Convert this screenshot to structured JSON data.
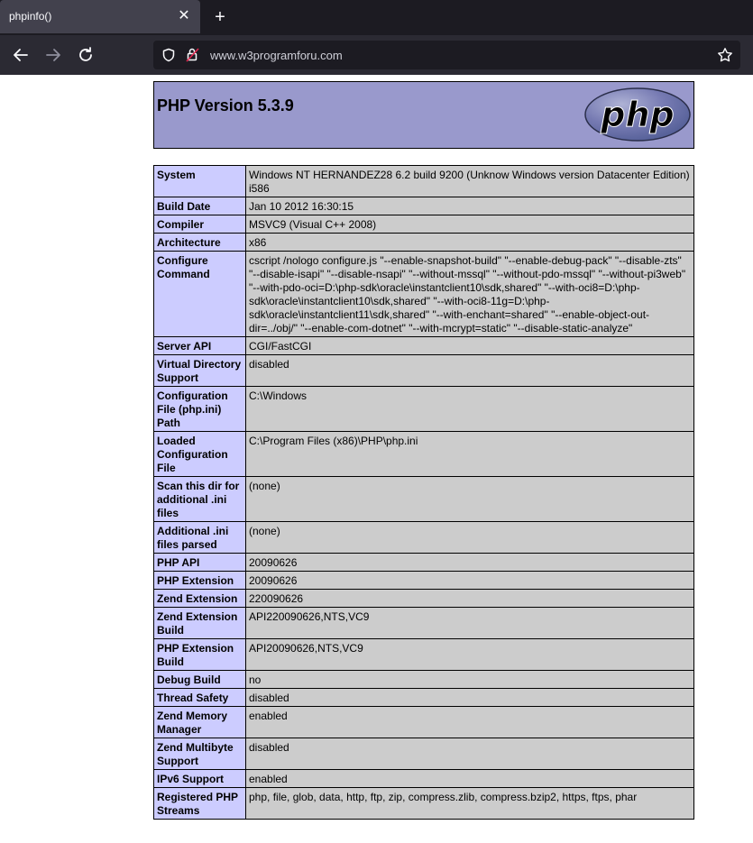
{
  "browser": {
    "tab_title": "phpinfo()",
    "url": "www.w3programforu.com"
  },
  "colors": {
    "header_bg": "#9999cc",
    "label_bg": "#ccccff",
    "value_bg": "#cccccc"
  },
  "page": {
    "heading": "PHP Version 5.3.9",
    "logo_text": "php"
  },
  "rows": [
    {
      "label": "System",
      "value": "Windows NT HERNANDEZ28 6.2 build 9200 (Unknow Windows version Datacenter Edition) i586"
    },
    {
      "label": "Build Date",
      "value": "Jan 10 2012 16:30:15"
    },
    {
      "label": "Compiler",
      "value": "MSVC9 (Visual C++ 2008)"
    },
    {
      "label": "Architecture",
      "value": "x86"
    },
    {
      "label": "Configure Command",
      "value": "cscript /nologo configure.js \"--enable-snapshot-build\" \"--enable-debug-pack\" \"--disable-zts\" \"--disable-isapi\" \"--disable-nsapi\" \"--without-mssql\" \"--without-pdo-mssql\" \"--without-pi3web\" \"--with-pdo-oci=D:\\php-sdk\\oracle\\instantclient10\\sdk,shared\" \"--with-oci8=D:\\php-sdk\\oracle\\instantclient10\\sdk,shared\" \"--with-oci8-11g=D:\\php-sdk\\oracle\\instantclient11\\sdk,shared\" \"--with-enchant=shared\" \"--enable-object-out-dir=../obj/\" \"--enable-com-dotnet\" \"--with-mcrypt=static\" \"--disable-static-analyze\""
    },
    {
      "label": "Server API",
      "value": "CGI/FastCGI"
    },
    {
      "label": "Virtual Directory Support",
      "value": "disabled"
    },
    {
      "label": "Configuration File (php.ini) Path",
      "value": "C:\\Windows"
    },
    {
      "label": "Loaded Configuration File",
      "value": "C:\\Program Files (x86)\\PHP\\php.ini"
    },
    {
      "label": "Scan this dir for additional .ini files",
      "value": "(none)"
    },
    {
      "label": "Additional .ini files parsed",
      "value": "(none)"
    },
    {
      "label": "PHP API",
      "value": "20090626"
    },
    {
      "label": "PHP Extension",
      "value": "20090626"
    },
    {
      "label": "Zend Extension",
      "value": "220090626"
    },
    {
      "label": "Zend Extension Build",
      "value": "API220090626,NTS,VC9"
    },
    {
      "label": "PHP Extension Build",
      "value": "API20090626,NTS,VC9"
    },
    {
      "label": "Debug Build",
      "value": "no"
    },
    {
      "label": "Thread Safety",
      "value": "disabled"
    },
    {
      "label": "Zend Memory Manager",
      "value": "enabled"
    },
    {
      "label": "Zend Multibyte Support",
      "value": "disabled"
    },
    {
      "label": "IPv6 Support",
      "value": "enabled"
    },
    {
      "label": "Registered PHP Streams",
      "value": "php, file, glob, data, http, ftp, zip, compress.zlib, compress.bzip2, https, ftps, phar"
    }
  ]
}
